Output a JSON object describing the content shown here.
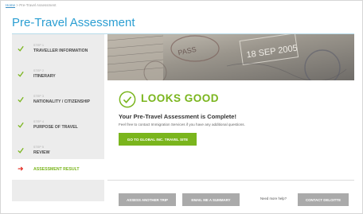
{
  "breadcrumb": {
    "home": "Home",
    "separator": ">",
    "current": "Pre-Travel Assessment"
  },
  "page": {
    "title": "Pre-Travel Assessment"
  },
  "steps": [
    {
      "num": "STEP 1",
      "label": "TRAVELLER INFORMATION",
      "status": "complete",
      "icon": "check-circle-icon"
    },
    {
      "num": "STEP 2",
      "label": "ITINERARY",
      "status": "complete",
      "icon": "check-circle-icon"
    },
    {
      "num": "STEP 3",
      "label": "NATIONALITY / CITIZENSHIP",
      "status": "complete",
      "icon": "check-circle-icon"
    },
    {
      "num": "STEP 4",
      "label": "PURPOSE OF TRAVEL",
      "status": "complete",
      "icon": "check-circle-icon"
    },
    {
      "num": "STEP 5",
      "label": "REVIEW",
      "status": "complete",
      "icon": "check-circle-icon"
    },
    {
      "num": "",
      "label": "ASSESSMENT RESULT",
      "status": "active",
      "icon": "arrow-right-icon"
    }
  ],
  "banner": {
    "stamp_text": "18 SEP 2005",
    "description": "passport stamps image"
  },
  "result": {
    "headline": "LOOKS GOOD",
    "title": "Your Pre-Travel Assessment is Complete!",
    "subtitle": "Feel free to contact Immigration Services if you have any additional questions.",
    "primary_button": "GO TO GLOBAL INC. TRAVEL SITE"
  },
  "footer": {
    "assess_button": "ASSESS ANOTHER TRIP",
    "email_button": "EMAIL ME A SUMMARY",
    "help_text": "Need more help?",
    "contact_button": "CONTACT DELOITTE"
  },
  "colors": {
    "accent_blue": "#2a9ed2",
    "accent_green": "#7ab51d",
    "active_arrow": "#e2231a",
    "gray_button": "#aaaaaa"
  }
}
